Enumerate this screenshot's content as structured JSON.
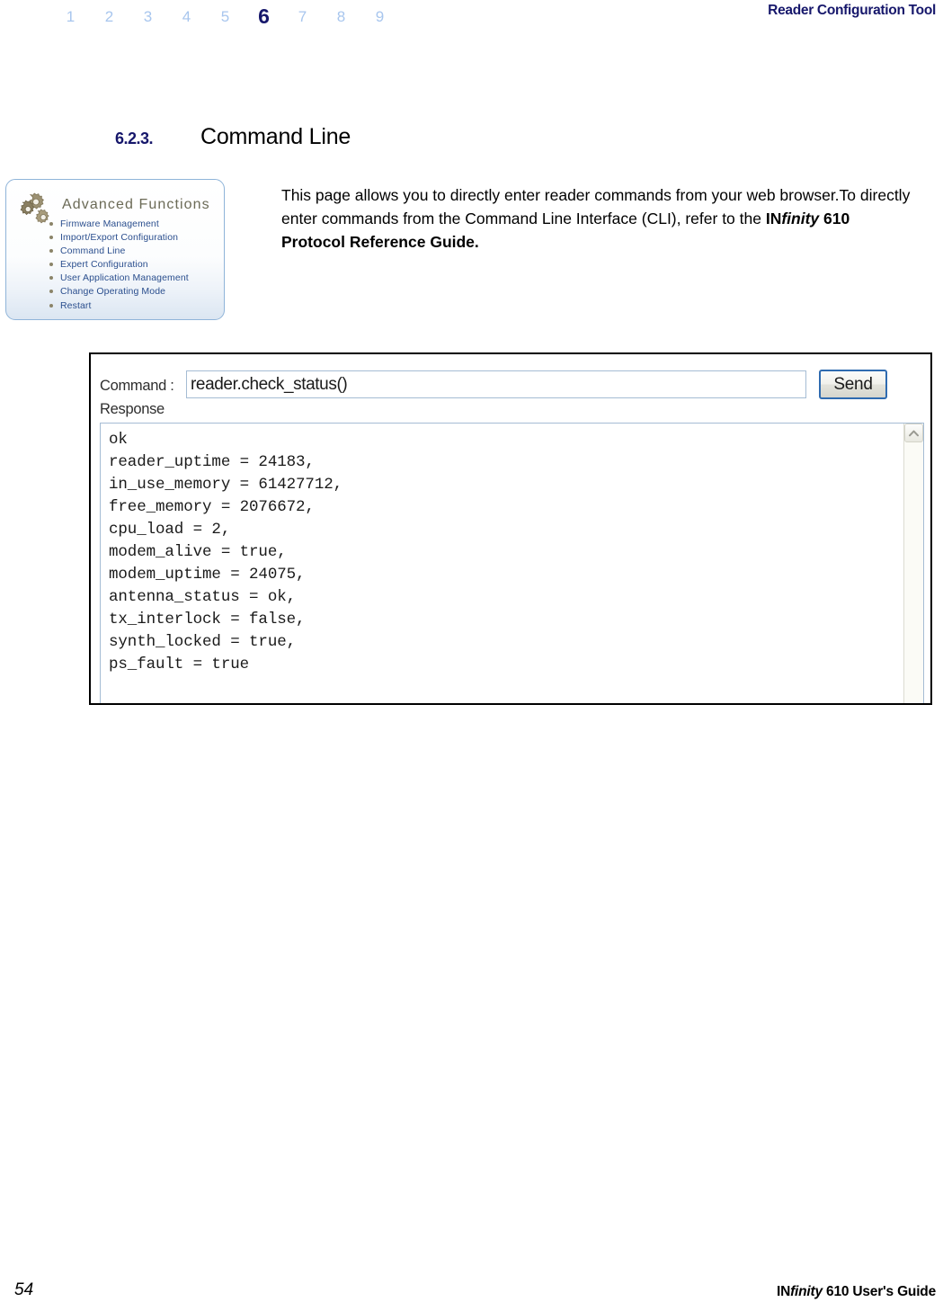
{
  "header": {
    "chapter_numbers": [
      "1",
      "2",
      "3",
      "4",
      "5",
      "6",
      "7",
      "8",
      "9"
    ],
    "active_chapter": "6",
    "title": "Reader Configuration Tool",
    "active_color": "#16176b",
    "inactive_color": "#a8c6ee"
  },
  "section": {
    "number": "6.2.3.",
    "title": "Command Line",
    "number_color": "#16176b"
  },
  "paragraph": {
    "part1": "This page allows you to directly enter reader commands from your web browser.To directly enter commands from the Command Line Interface (CLI), refer to the ",
    "bold_in": "IN",
    "bold_italic_finity": "finity",
    "bold_rest": " 610 Protocol Reference Guide."
  },
  "advanced_functions": {
    "icon": "gears-icon",
    "title": "Advanced Functions",
    "title_color": "#6b6a56",
    "link_color": "#2b4f8e",
    "items": [
      "Firmware Management",
      "Import/Export Configuration",
      "Command Line",
      "Expert Configuration",
      "User Application Management",
      "Change Operating Mode",
      "Restart"
    ]
  },
  "cli": {
    "command_label": "Command :",
    "command_value": "reader.check_status()",
    "command_placeholder": "",
    "send_label": "Send",
    "response_label": "Response",
    "scroll_up_icon": "chevron-up-icon",
    "response_text": "ok\nreader_uptime = 24183,\nin_use_memory = 61427712,\nfree_memory = 2076672,\ncpu_load = 2,\nmodem_alive = true,\nmodem_uptime = 24075,\nantenna_status = ok,\ntx_interlock = false,\nsynth_locked = true,\nps_fault = true",
    "response_lines": [
      "ok",
      "reader_uptime = 24183,",
      "in_use_memory = 61427712,",
      "free_memory = 2076672,",
      "cpu_load = 2,",
      "modem_alive = true,",
      "modem_uptime = 24075,",
      "antenna_status = ok,",
      "tx_interlock = false,",
      "synth_locked = true,",
      "ps_fault = true"
    ]
  },
  "footer": {
    "page_number": "54",
    "guide_in": "IN",
    "guide_finity": "finity",
    "guide_rest": " 610 User's Guide"
  }
}
